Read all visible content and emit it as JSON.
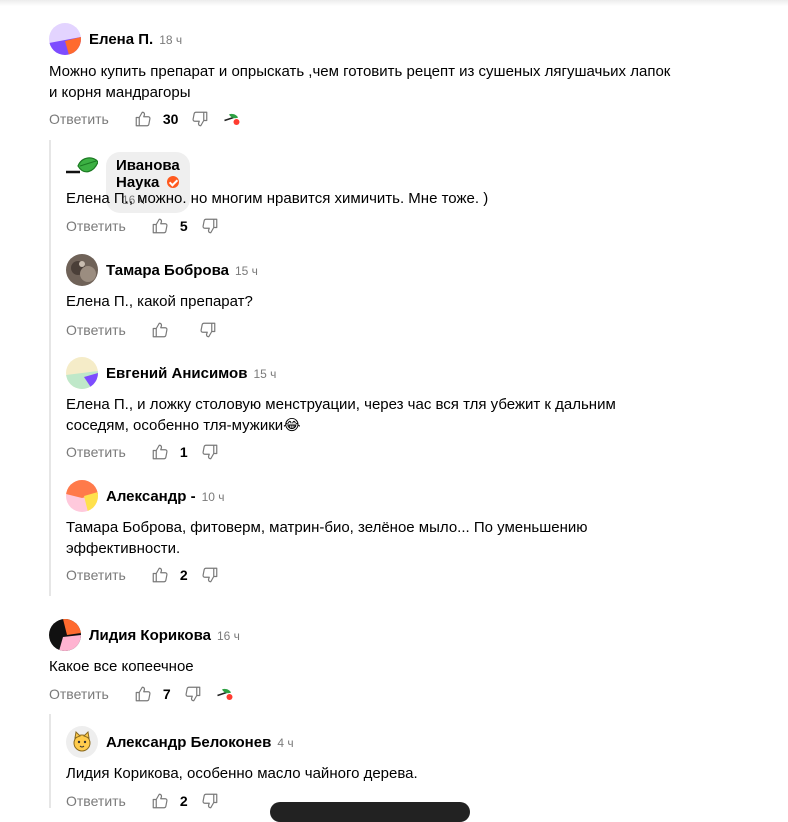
{
  "comments": [
    {
      "author": "Елена П.",
      "time": "18 ч",
      "text": "Можно купить препарат и опрыскать ,чем готовить рецепт из сушеных лягушачьих лапок и корня мандрагоры",
      "reply_label": "Ответить",
      "likes": "30"
    },
    {
      "author": "Иванова Наука",
      "time": "16 ч",
      "text": "Елена П., можно. но многим нравится химичить. Мне тоже. )",
      "reply_label": "Ответить",
      "likes": "5"
    },
    {
      "author": "Тамара Боброва",
      "time": "15 ч",
      "text": "Елена П., какой препарат?",
      "reply_label": "Ответить",
      "likes": ""
    },
    {
      "author": "Евгений Анисимов",
      "time": "15 ч",
      "text": "Елена П., и ложку столовую менструации, через час вся тля убежит к дальним соседям, особенно тля-мужики😂",
      "reply_label": "Ответить",
      "likes": "1"
    },
    {
      "author": "Александр -",
      "time": "10 ч",
      "text": "Тамара Боброва, фитоверм, матрин-био, зелёное мыло... По уменьшению эффективности.",
      "reply_label": "Ответить",
      "likes": "2"
    },
    {
      "author": "Лидия Корикова",
      "time": "16 ч",
      "text": "Какое все копеечное",
      "reply_label": "Ответить",
      "likes": "7"
    },
    {
      "author": "Александр Белоконев",
      "time": "4 ч",
      "text": "Лидия Корикова, особенно масло чайного дерева.",
      "reply_label": "Ответить",
      "likes": "2"
    }
  ],
  "colors": {
    "verified": "#ff5a1f",
    "thread_line": "#e6e6e6",
    "muted_text": "#7a7a7a"
  },
  "icons": [
    "like-icon",
    "dislike-icon",
    "author-heart-icon",
    "verified-icon"
  ]
}
